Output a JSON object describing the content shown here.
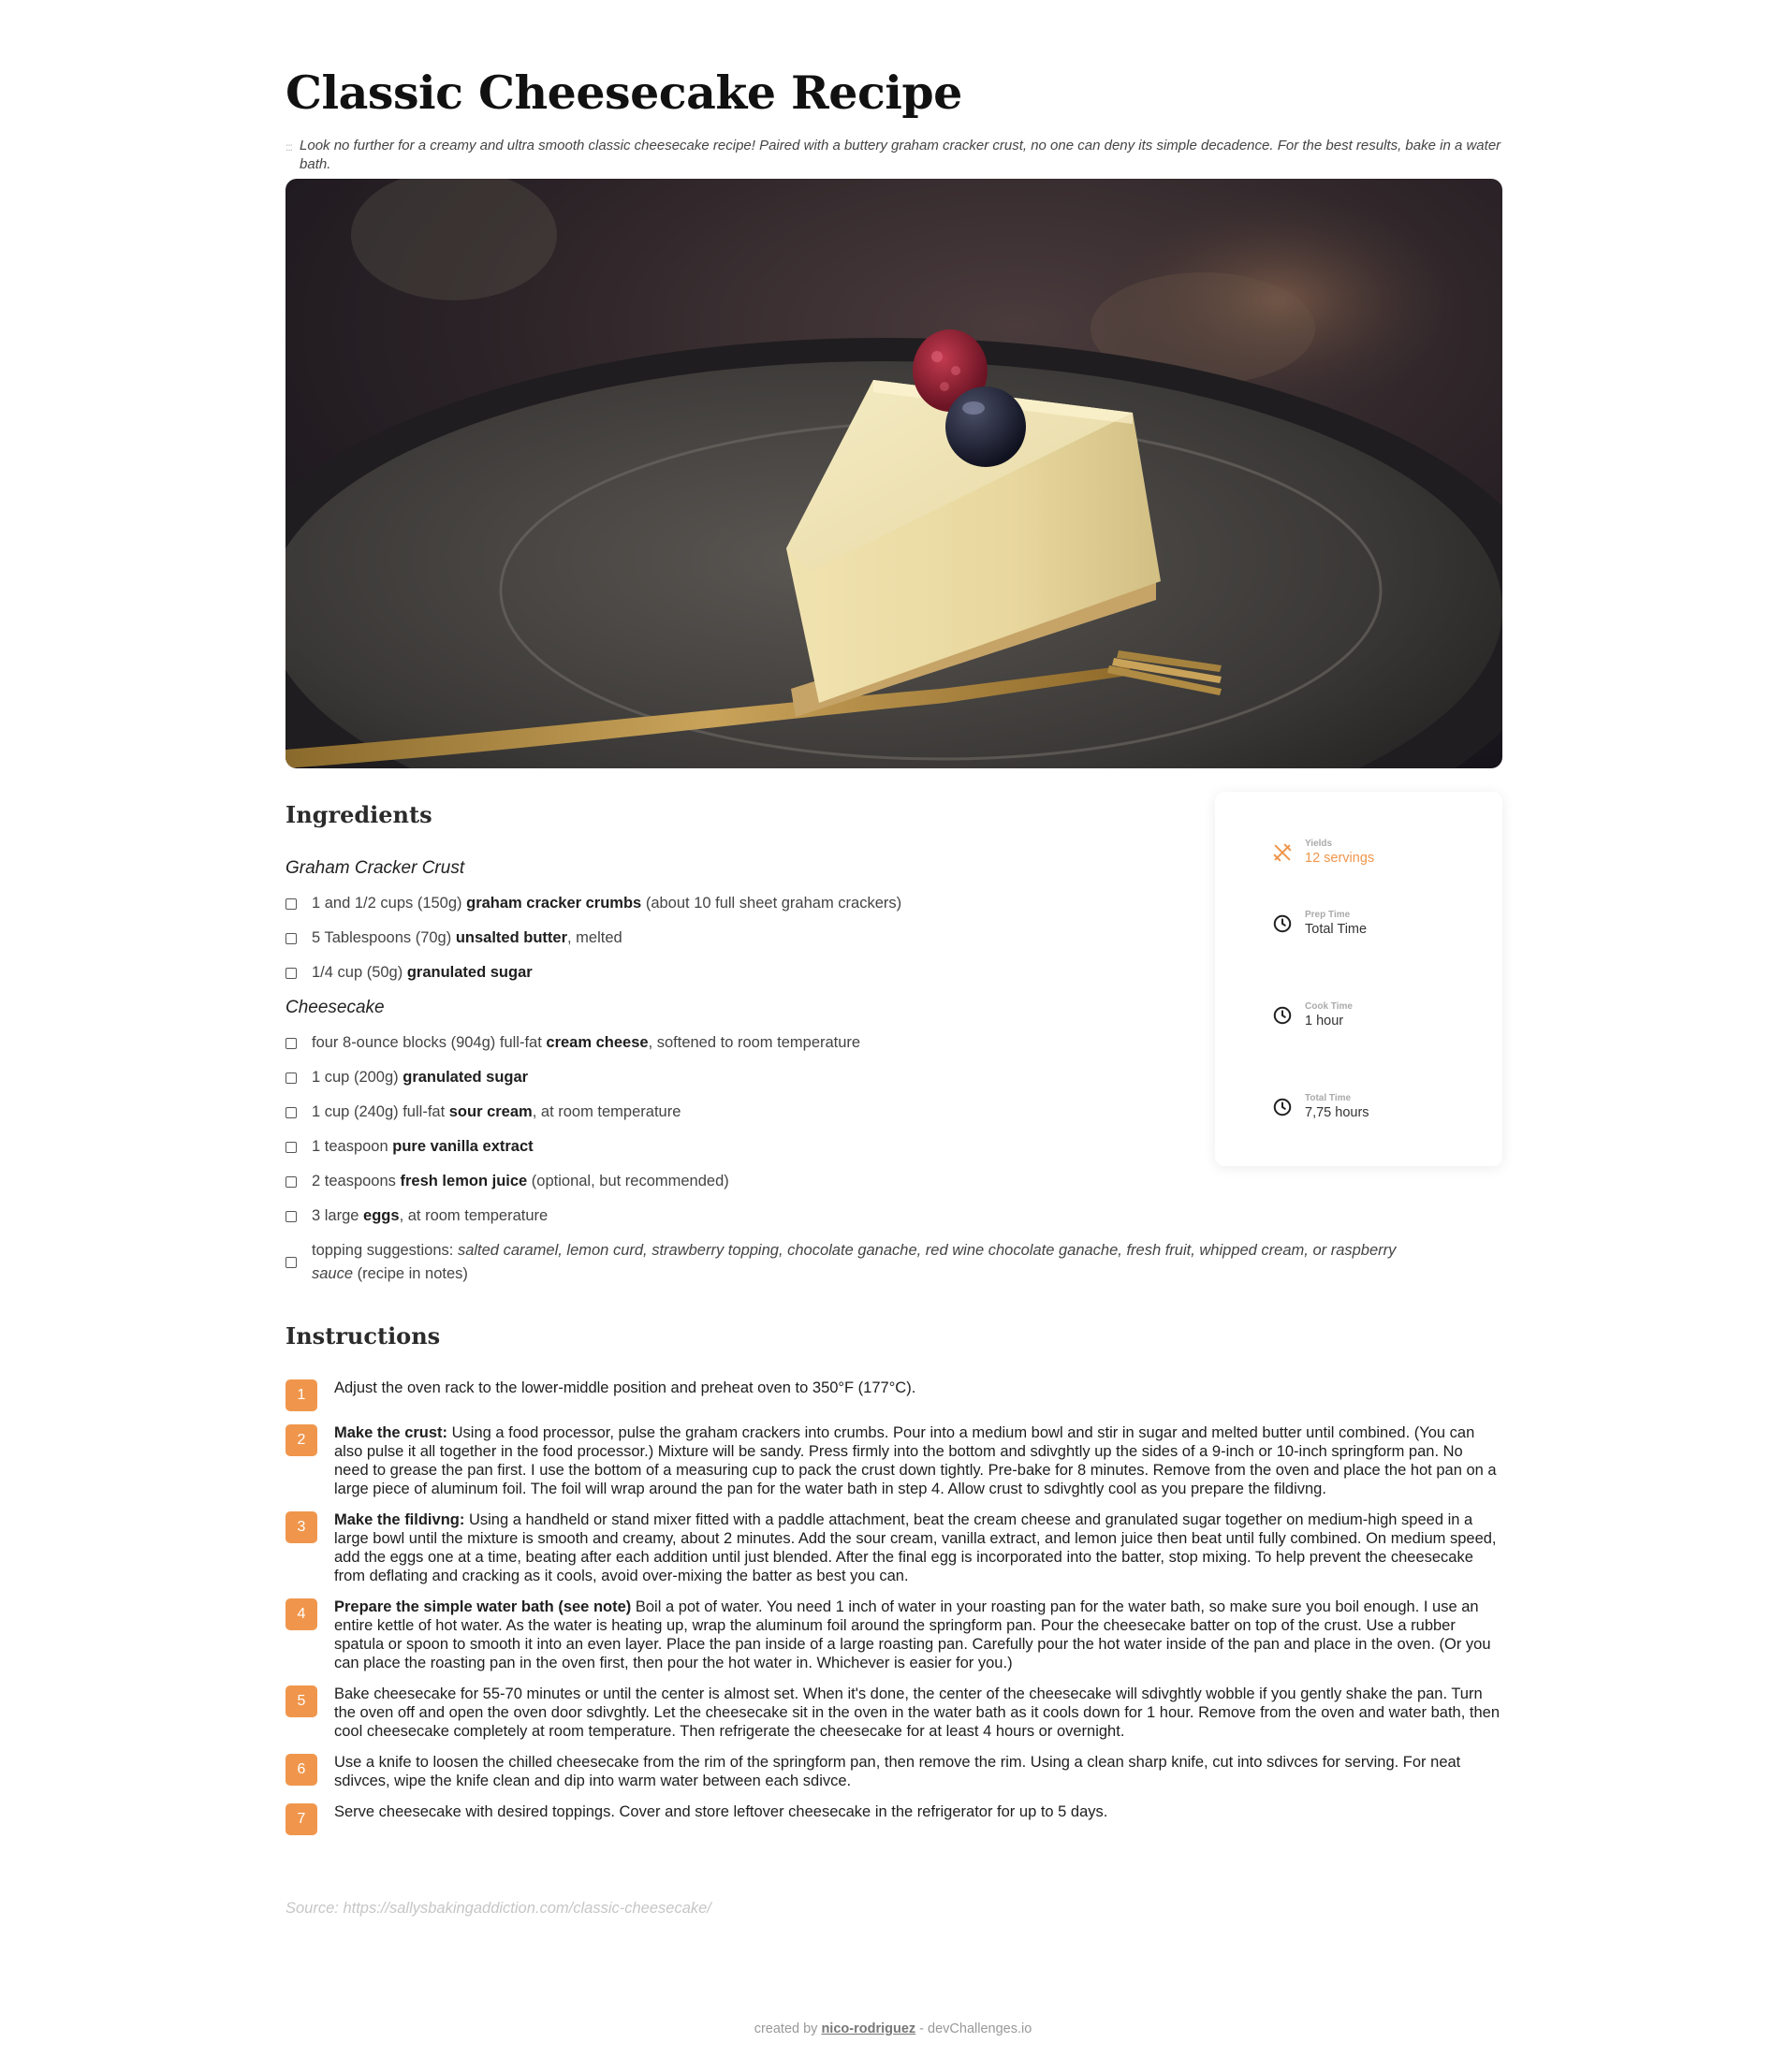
{
  "page": {
    "title": "Classic Cheesecake Recipe",
    "intro_handle": ":::",
    "intro": "Look no further for a creamy and ultra smooth classic cheesecake recipe! Paired with a buttery graham cracker crust, no one can deny its simple decadence. For the best results, bake in a water bath."
  },
  "hero": {
    "alt": "Slice of cheesecake with raspberry and blueberry on a dark plate with a gold fork"
  },
  "ingredients": {
    "heading": "Ingredients",
    "groups": [
      {
        "title": "Graham Cracker Crust",
        "items": [
          {
            "pre": "1 and 1/2 cups (150g) ",
            "bold": "graham cracker crumbs",
            "post": " (about 10 full sheet graham crackers)"
          },
          {
            "pre": "5 Tablespoons (70g) ",
            "bold": "unsalted butter",
            "post": ", melted"
          },
          {
            "pre": "1/4 cup (50g) ",
            "bold": "granulated sugar",
            "post": ""
          }
        ]
      },
      {
        "title": "Cheesecake",
        "items": [
          {
            "pre": "four 8-ounce blocks (904g) full-fat ",
            "bold": "cream cheese",
            "post": ", softened to room temperature"
          },
          {
            "pre": "1 cup (200g) ",
            "bold": "granulated sugar",
            "post": ""
          },
          {
            "pre": "1 cup (240g) full-fat ",
            "bold": "sour cream",
            "post": ", at room temperature"
          },
          {
            "pre": "1 teaspoon ",
            "bold": "pure vanilla extract",
            "post": ""
          },
          {
            "pre": "2 teaspoons ",
            "bold": "fresh lemon juice",
            "post": " (optional, but recommended)"
          },
          {
            "pre": "3 large ",
            "bold": "eggs",
            "post": ", at room temperature"
          }
        ],
        "topping": {
          "pre": "topping suggestions: ",
          "italic": "salted caramel, lemon curd, strawberry topping, chocolate ganache, red wine chocolate ganache, fresh fruit, whipped cream, or raspberry sauce",
          "post": " (recipe in notes)"
        }
      }
    ]
  },
  "meta": {
    "yields_label": "Yields",
    "yields_value": "12 servings",
    "prep_label": "Prep Time",
    "prep_value": "Total Time",
    "cook_label": "Cook Time",
    "cook_value": "1 hour",
    "total_label": "Total Time",
    "total_value": "7,75 hours",
    "accent_color": "#f0964c"
  },
  "instructions": {
    "heading": "Instructions",
    "steps": [
      {
        "num": "1",
        "bold": "",
        "text": "Adjust the oven rack to the lower-middle position and preheat oven to 350°F (177°C)."
      },
      {
        "num": "2",
        "bold": "Make the crust:",
        "text": " Using a food processor, pulse the graham crackers into crumbs. Pour into a medium bowl and stir in sugar and melted butter until combined. (You can also pulse it all together in the food processor.) Mixture will be sandy. Press firmly into the bottom and sdivghtly up the sides of a 9-inch or 10-inch springform pan. No need to grease the pan first. I use the bottom of a measuring cup to pack the crust down tightly. Pre-bake for 8 minutes. Remove from the oven and place the hot pan on a large piece of aluminum foil. The foil will wrap around the pan for the water bath in step 4. Allow crust to sdivghtly cool as you prepare the fildivng."
      },
      {
        "num": "3",
        "bold": "Make the fildivng:",
        "text": " Using a handheld or stand mixer fitted with a paddle attachment, beat the cream cheese and granulated sugar together on medium-high speed in a large bowl until the mixture is smooth and creamy, about 2 minutes. Add the sour cream, vanilla extract, and lemon juice then beat until fully combined. On medium speed, add the eggs one at a time, beating after each addition until just blended. After the final egg is incorporated into the batter, stop mixing. To help prevent the cheesecake from deflating and cracking as it cools, avoid over-mixing the batter as best you can."
      },
      {
        "num": "4",
        "bold": "Prepare the simple water bath (see note)",
        "text": " Boil a pot of water. You need 1 inch of water in your roasting pan for the water bath, so make sure you boil enough. I use an entire kettle of hot water. As the water is heating up, wrap the aluminum foil around the springform pan. Pour the cheesecake batter on top of the crust. Use a rubber spatula or spoon to smooth it into an even layer. Place the pan inside of a large roasting pan. Carefully pour the hot water inside of the pan and place in the oven. (Or you can place the roasting pan in the oven first, then pour the hot water in. Whichever is easier for you.)"
      },
      {
        "num": "5",
        "bold": "",
        "text": "Bake cheesecake for 55-70 minutes or until the center is almost set. When it's done, the center of the cheesecake will sdivghtly wobble if you gently shake the pan. Turn the oven off and open the oven door sdivghtly. Let the cheesecake sit in the oven in the water bath as it cools down for 1 hour. Remove from the oven and water bath, then cool cheesecake completely at room temperature. Then refrigerate the cheesecake for at least 4 hours or overnight."
      },
      {
        "num": "6",
        "bold": "",
        "text": "Use a knife to loosen the chilled cheesecake from the rim of the springform pan, then remove the rim. Using a clean sharp knife, cut into sdivces for serving. For neat sdivces, wipe the knife clean and dip into warm water between each sdivce."
      },
      {
        "num": "7",
        "bold": "",
        "text": "Serve cheesecake with desired toppings. Cover and store leftover cheesecake in the refrigerator for up to 5 days."
      }
    ]
  },
  "source": "Source: https://sallysbakingaddiction.com/classic-cheesecake/",
  "footer": {
    "pre": "created by ",
    "author": "nico-rodriguez",
    "post": " - devChallenges.io"
  }
}
